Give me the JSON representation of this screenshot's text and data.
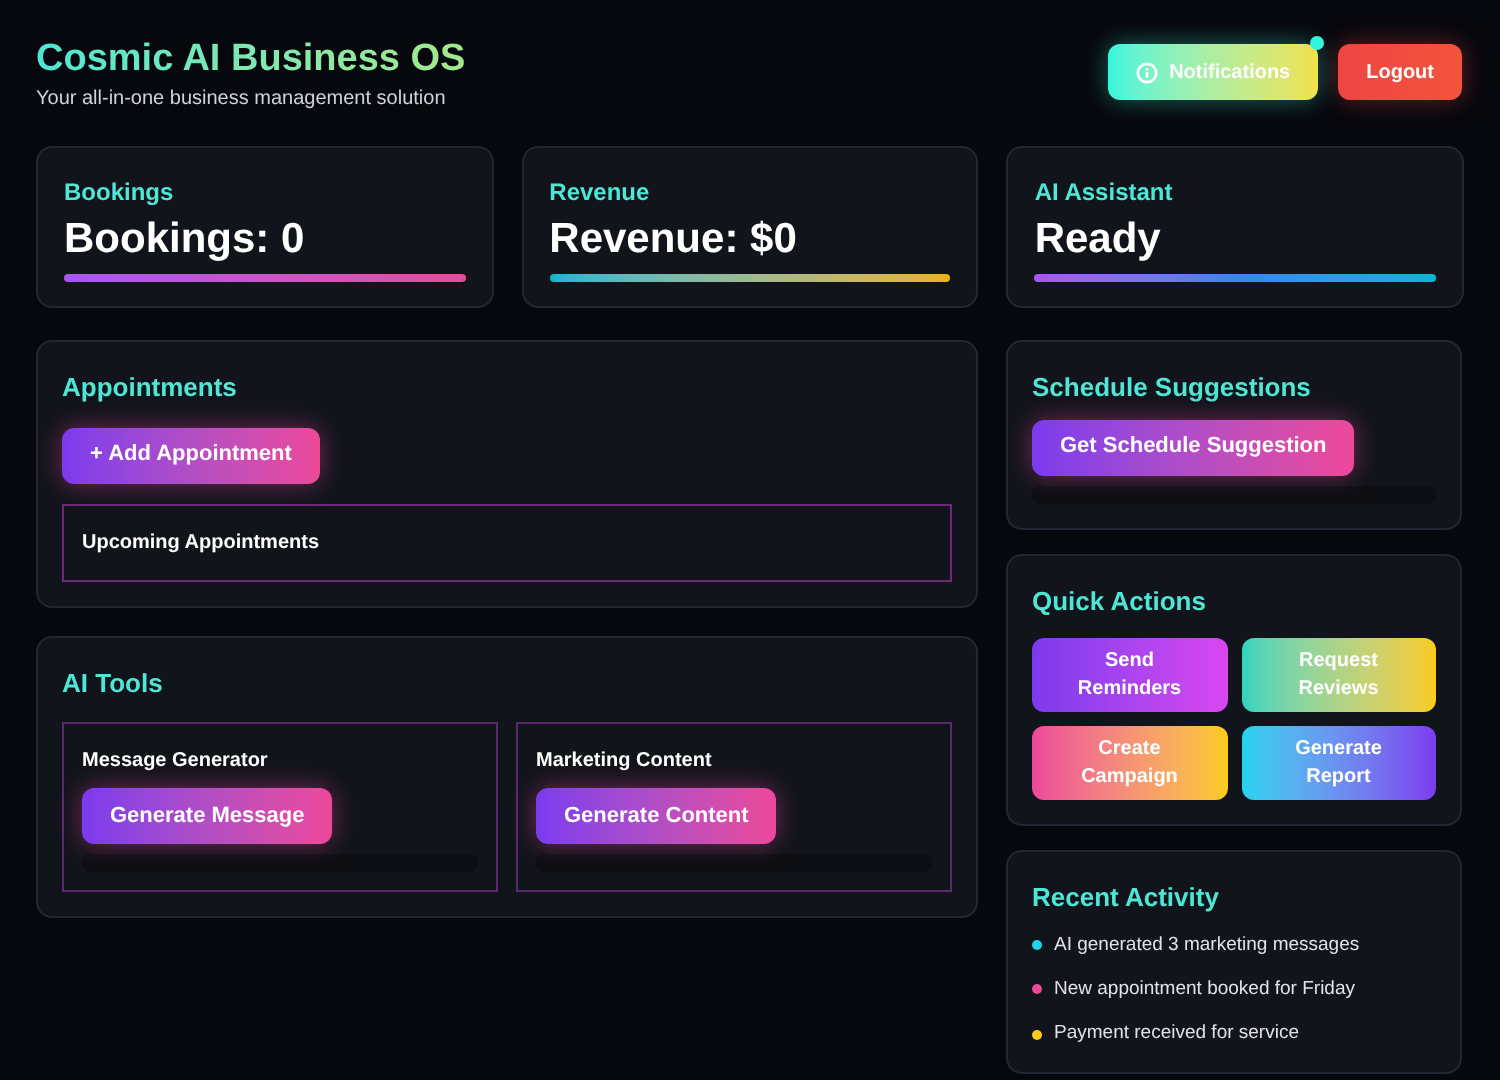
{
  "header": {
    "title": "Cosmic AI Business OS",
    "subtitle": "Your all-in-one business management solution",
    "notifications": {
      "label": "Notifications",
      "has_unread": true
    },
    "logout": "Logout"
  },
  "stats": [
    {
      "label": "Bookings",
      "value": "Bookings: 0"
    },
    {
      "label": "Revenue",
      "value": "Revenue: $0"
    },
    {
      "label": "AI Assistant",
      "value": "Ready"
    }
  ],
  "appointments": {
    "title": "Appointments",
    "add_button": "+ Add Appointment",
    "upcoming_title": "Upcoming Appointments"
  },
  "ai_tools": {
    "title": "AI Tools",
    "tools": [
      {
        "title": "Message Generator",
        "button": "Generate Message"
      },
      {
        "title": "Marketing Content",
        "button": "Generate Content"
      }
    ]
  },
  "schedule": {
    "title": "Schedule Suggestions",
    "button": "Get Schedule Suggestion"
  },
  "quick_actions": {
    "title": "Quick Actions",
    "actions": [
      "Send Reminders",
      "Request Reviews",
      "Create Campaign",
      "Generate Report"
    ]
  },
  "recent_activity": {
    "title": "Recent Activity",
    "items": [
      {
        "text": "AI generated 3 marketing messages",
        "color": "#22d3ee"
      },
      {
        "text": "New appointment booked for Friday",
        "color": "#ec4899"
      },
      {
        "text": "Payment received for service",
        "color": "#facc15"
      }
    ]
  }
}
